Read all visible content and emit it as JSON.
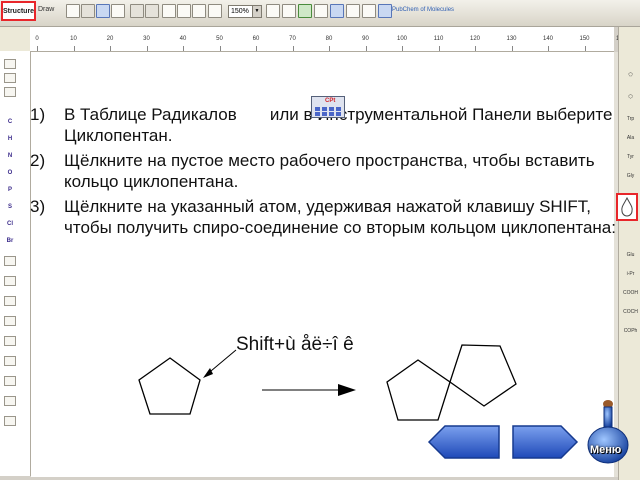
{
  "toolbar": {
    "structure_label": "Structure",
    "draw_label": "Draw",
    "zoom_value": "150%",
    "pubchem_label": "PubChem of Molecules"
  },
  "ruler": {
    "labels": [
      "0",
      "10",
      "20",
      "30",
      "40",
      "50",
      "60",
      "70",
      "80",
      "90",
      "100",
      "110",
      "120",
      "130",
      "140",
      "150",
      "160"
    ]
  },
  "left_palette": {
    "atoms": [
      "C",
      "H",
      "N",
      "O",
      "P",
      "S",
      "Cl",
      "Br"
    ]
  },
  "right_palette": {
    "items": [
      "Trp",
      "Ala",
      "Tyr",
      "Gly",
      "Glu",
      "i-Pr",
      "COOH",
      "COCH",
      "COPh"
    ]
  },
  "instructions": [
    {
      "num": "1)",
      "text": "В Таблице Радикалов       или в Инструментальной Панели выберите Циклопентан."
    },
    {
      "num": "2)",
      "text": "Щёлкните на пустое место рабочего пространства, чтобы вставить кольцо циклопентана."
    },
    {
      "num": "3)",
      "text": "Щёлкните на указанный атом, удерживая нажатой клавишу SHIFT, чтобы получить спиро-соединение со вторым кольцом циклопентана:"
    }
  ],
  "radical_icon_label": "CPt",
  "shift_label": "Shift+ù åë÷î ê",
  "nav": {
    "menu_label": "Меню"
  },
  "colors": {
    "highlight": "#e8262a",
    "button_blue": "#2d5fd0"
  }
}
